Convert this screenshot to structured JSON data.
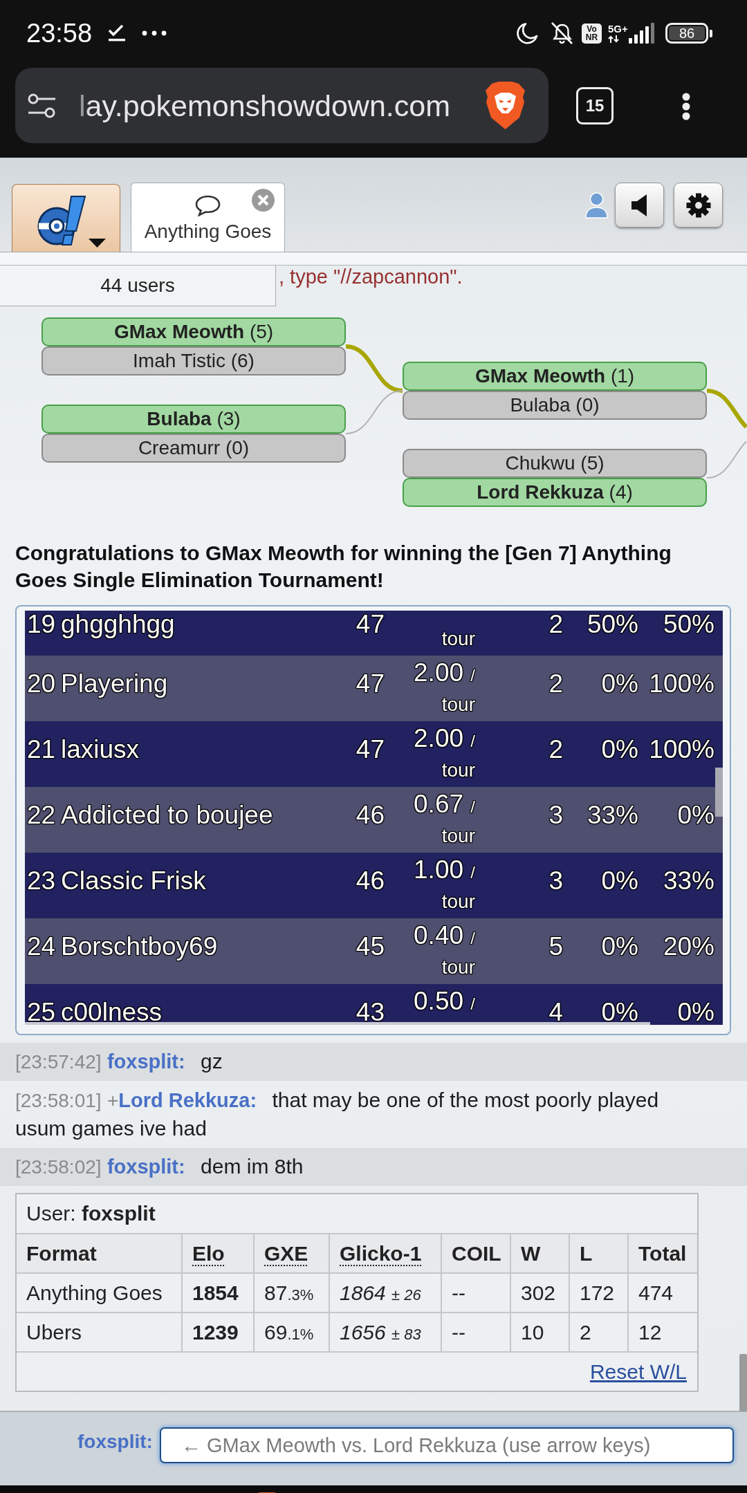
{
  "status_bar": {
    "time": "23:58",
    "network_badge": [
      "Vo",
      "NR"
    ],
    "network_type": "5G+",
    "battery": "86"
  },
  "browser": {
    "url": "lay.pokemonshowdown.com",
    "tab_count": "15"
  },
  "header": {
    "tabs": [
      {
        "label": "Anything Goes",
        "selected": true
      }
    ]
  },
  "room": {
    "user_count": "44 users",
    "chat_fragment": ", type \"//zapcannon\"."
  },
  "bracket": {
    "rounds": [
      {
        "matches": [
          {
            "highlighted": true,
            "players": [
              {
                "name": "GMax Meowth",
                "score": "(5)",
                "winner": true
              },
              {
                "name": "Imah Tistic",
                "score": "(6)",
                "winner": false
              }
            ]
          },
          {
            "highlighted": false,
            "players": [
              {
                "name": "Bulaba",
                "score": "(3)",
                "winner": true
              },
              {
                "name": "Creamurr",
                "score": "(0)",
                "winner": false
              }
            ]
          }
        ]
      },
      {
        "matches": [
          {
            "highlighted": true,
            "players": [
              {
                "name": "GMax Meowth",
                "score": "(1)",
                "winner": true
              },
              {
                "name": "Bulaba",
                "score": "(0)",
                "winner": false
              }
            ]
          },
          {
            "highlighted": false,
            "players": [
              {
                "name": "Chukwu",
                "score": "(5)",
                "winner": false
              },
              {
                "name": "Lord Rekkuza",
                "score": "(4)",
                "winner": true
              }
            ]
          }
        ]
      }
    ]
  },
  "announcement": "Congratulations to GMax Meowth for winning the [Gen 7] Anything Goes Single Elimination Tournament!",
  "results": {
    "rows": [
      {
        "column_1": "19",
        "column_2": "ghgghhgg",
        "column_3": "47",
        "column_4": {
          "unit": "tour"
        },
        "column_5": "2",
        "column_6": "50%",
        "column_7": "50%"
      },
      {
        "column_1": "20",
        "column_2": "Playering",
        "column_3": "47",
        "column_4": {
          "value": "2.00",
          "per": "/",
          "unit": "tour"
        },
        "column_5": "2",
        "column_6": "0%",
        "column_7": "100%"
      },
      {
        "column_1": "21",
        "column_2": "laxiusx",
        "column_3": "47",
        "column_4": {
          "value": "2.00",
          "per": "/",
          "unit": "tour"
        },
        "column_5": "2",
        "column_6": "0%",
        "column_7": "100%"
      },
      {
        "column_1": "22",
        "column_2": "Addicted to boujee",
        "column_3": "46",
        "column_4": {
          "value": "0.67",
          "per": "/",
          "unit": "tour"
        },
        "column_5": "3",
        "column_6": "33%",
        "column_7": "0%"
      },
      {
        "column_1": "23",
        "column_2": "Classic Frisk",
        "column_3": "46",
        "column_4": {
          "value": "1.00",
          "per": "/",
          "unit": "tour"
        },
        "column_5": "3",
        "column_6": "0%",
        "column_7": "33%"
      },
      {
        "column_1": "24",
        "column_2": "Borschtboy69",
        "column_3": "45",
        "column_4": {
          "value": "0.40",
          "per": "/",
          "unit": "tour"
        },
        "column_5": "5",
        "column_6": "0%",
        "column_7": "20%"
      },
      {
        "column_1": "25",
        "column_2": "c00lness",
        "column_3": "43",
        "column_4": {
          "value": "0.50",
          "per": "/"
        },
        "column_5": "4",
        "column_6": "0%",
        "column_7": "0%"
      }
    ]
  },
  "chat": {
    "messages": [
      {
        "time": "[23:57:42]",
        "user": "foxsplit:",
        "text": "gz",
        "mine": true
      },
      {
        "time": "[23:58:01]",
        "rank": "+",
        "user": "Lord Rekkuza:",
        "text": "that may be one of the most poorly played usum games ive had",
        "mine": false
      },
      {
        "time": "[23:58:02]",
        "user": "foxsplit:",
        "text": "dem im 8th",
        "mine": true
      }
    ]
  },
  "user_stats": {
    "user": "User: **foxsplit**",
    "columns": [
      {
        "label": "Format",
        "abbr": false
      },
      {
        "label": "Elo",
        "abbr": true
      },
      {
        "label": "GXE",
        "abbr": true
      },
      {
        "label": "Glicko-1",
        "abbr": true
      },
      {
        "label": "COIL",
        "abbr": false
      },
      {
        "label": "W",
        "abbr": false
      },
      {
        "label": "L",
        "abbr": false
      },
      {
        "label": "Total",
        "abbr": false
      }
    ],
    "rows": [
      {
        "format": "Anything Goes",
        "elo": "1854",
        "gxe": {
          "whole": "87",
          "fraction": ".3%"
        },
        "glicko": {
          "rating": "1864",
          "deviation": "± 26"
        },
        "coil": "--",
        "w": "302",
        "l": "172",
        "total": "474"
      },
      {
        "format": "Ubers",
        "elo": "1239",
        "gxe": {
          "whole": "69",
          "fraction": ".1%"
        },
        "glicko": {
          "rating": "1656",
          "deviation": "± 83"
        },
        "coil": "--",
        "w": "10",
        "l": "2",
        "total": "12"
      }
    ],
    "reset_link": "Reset W/L"
  },
  "chat_input": {
    "user": "foxsplit:",
    "placeholder": "← GMax Meowth vs. Lord Rekkuza (use arrow keys)"
  }
}
